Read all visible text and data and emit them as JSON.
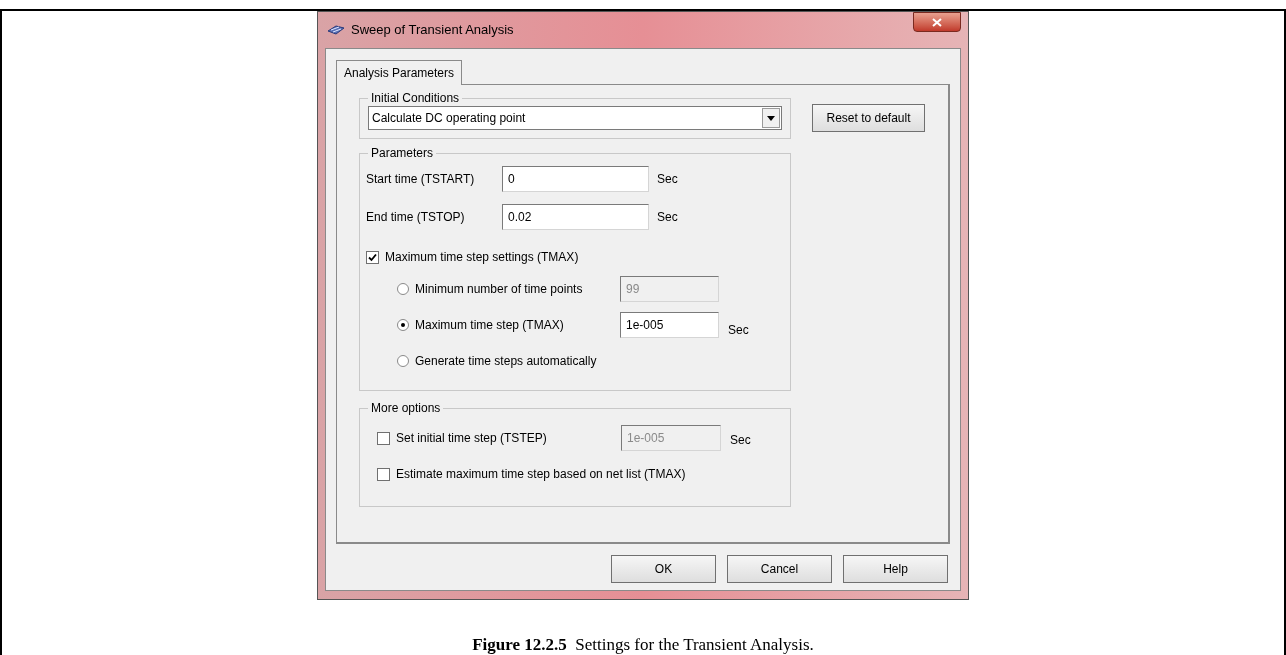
{
  "window": {
    "title": "Sweep of Transient Analysis"
  },
  "tabs": [
    {
      "label": "Analysis Parameters",
      "selected": true
    }
  ],
  "initial_conditions": {
    "legend": "Initial Conditions",
    "value": "Calculate DC operating point"
  },
  "reset_button": "Reset to default",
  "parameters": {
    "legend": "Parameters",
    "fields": [
      {
        "label": "Start time (TSTART)",
        "value": "0",
        "unit": "Sec"
      },
      {
        "label": "End time (TSTOP)",
        "value": "0.02",
        "unit": "Sec"
      }
    ],
    "tmax_checkbox": {
      "label": "Maximum time step settings (TMAX)",
      "checked": true
    },
    "options": [
      {
        "label": "Minimum number of time points",
        "selected": false,
        "value": "99",
        "disabled": true
      },
      {
        "label": "Maximum time step (TMAX)",
        "selected": true,
        "value": "1e-005",
        "unit": "Sec",
        "disabled": false
      },
      {
        "label": "Generate time steps automatically",
        "selected": false
      }
    ]
  },
  "more_options": {
    "legend": "More options",
    "items": [
      {
        "label": "Set initial time step (TSTEP)",
        "checked": false,
        "value": "1e-005",
        "unit": "Sec",
        "disabled": true
      },
      {
        "label": "Estimate maximum time step based on net list (TMAX)",
        "checked": false
      }
    ]
  },
  "buttons": [
    "OK",
    "Cancel",
    "Help"
  ],
  "caption": "**Figure 12.2.5**  Settings for the Transient Analysis."
}
